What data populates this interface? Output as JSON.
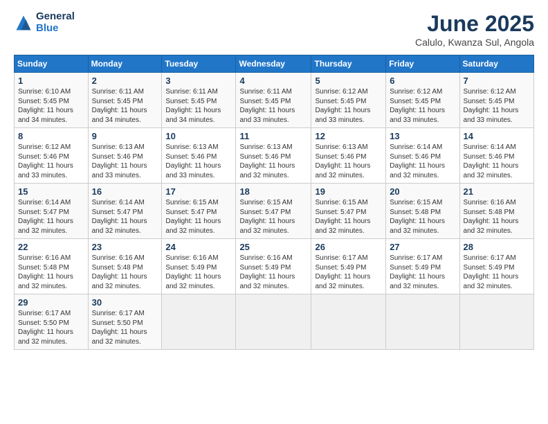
{
  "logo": {
    "line1": "General",
    "line2": "Blue"
  },
  "title": "June 2025",
  "subtitle": "Calulo, Kwanza Sul, Angola",
  "days_of_week": [
    "Sunday",
    "Monday",
    "Tuesday",
    "Wednesday",
    "Thursday",
    "Friday",
    "Saturday"
  ],
  "weeks": [
    [
      {
        "day": "1",
        "info": "Sunrise: 6:10 AM\nSunset: 5:45 PM\nDaylight: 11 hours\nand 34 minutes."
      },
      {
        "day": "2",
        "info": "Sunrise: 6:11 AM\nSunset: 5:45 PM\nDaylight: 11 hours\nand 34 minutes."
      },
      {
        "day": "3",
        "info": "Sunrise: 6:11 AM\nSunset: 5:45 PM\nDaylight: 11 hours\nand 34 minutes."
      },
      {
        "day": "4",
        "info": "Sunrise: 6:11 AM\nSunset: 5:45 PM\nDaylight: 11 hours\nand 33 minutes."
      },
      {
        "day": "5",
        "info": "Sunrise: 6:12 AM\nSunset: 5:45 PM\nDaylight: 11 hours\nand 33 minutes."
      },
      {
        "day": "6",
        "info": "Sunrise: 6:12 AM\nSunset: 5:45 PM\nDaylight: 11 hours\nand 33 minutes."
      },
      {
        "day": "7",
        "info": "Sunrise: 6:12 AM\nSunset: 5:45 PM\nDaylight: 11 hours\nand 33 minutes."
      }
    ],
    [
      {
        "day": "8",
        "info": "Sunrise: 6:12 AM\nSunset: 5:46 PM\nDaylight: 11 hours\nand 33 minutes."
      },
      {
        "day": "9",
        "info": "Sunrise: 6:13 AM\nSunset: 5:46 PM\nDaylight: 11 hours\nand 33 minutes."
      },
      {
        "day": "10",
        "info": "Sunrise: 6:13 AM\nSunset: 5:46 PM\nDaylight: 11 hours\nand 33 minutes."
      },
      {
        "day": "11",
        "info": "Sunrise: 6:13 AM\nSunset: 5:46 PM\nDaylight: 11 hours\nand 32 minutes."
      },
      {
        "day": "12",
        "info": "Sunrise: 6:13 AM\nSunset: 5:46 PM\nDaylight: 11 hours\nand 32 minutes."
      },
      {
        "day": "13",
        "info": "Sunrise: 6:14 AM\nSunset: 5:46 PM\nDaylight: 11 hours\nand 32 minutes."
      },
      {
        "day": "14",
        "info": "Sunrise: 6:14 AM\nSunset: 5:46 PM\nDaylight: 11 hours\nand 32 minutes."
      }
    ],
    [
      {
        "day": "15",
        "info": "Sunrise: 6:14 AM\nSunset: 5:47 PM\nDaylight: 11 hours\nand 32 minutes."
      },
      {
        "day": "16",
        "info": "Sunrise: 6:14 AM\nSunset: 5:47 PM\nDaylight: 11 hours\nand 32 minutes."
      },
      {
        "day": "17",
        "info": "Sunrise: 6:15 AM\nSunset: 5:47 PM\nDaylight: 11 hours\nand 32 minutes."
      },
      {
        "day": "18",
        "info": "Sunrise: 6:15 AM\nSunset: 5:47 PM\nDaylight: 11 hours\nand 32 minutes."
      },
      {
        "day": "19",
        "info": "Sunrise: 6:15 AM\nSunset: 5:47 PM\nDaylight: 11 hours\nand 32 minutes."
      },
      {
        "day": "20",
        "info": "Sunrise: 6:15 AM\nSunset: 5:48 PM\nDaylight: 11 hours\nand 32 minutes."
      },
      {
        "day": "21",
        "info": "Sunrise: 6:16 AM\nSunset: 5:48 PM\nDaylight: 11 hours\nand 32 minutes."
      }
    ],
    [
      {
        "day": "22",
        "info": "Sunrise: 6:16 AM\nSunset: 5:48 PM\nDaylight: 11 hours\nand 32 minutes."
      },
      {
        "day": "23",
        "info": "Sunrise: 6:16 AM\nSunset: 5:48 PM\nDaylight: 11 hours\nand 32 minutes."
      },
      {
        "day": "24",
        "info": "Sunrise: 6:16 AM\nSunset: 5:49 PM\nDaylight: 11 hours\nand 32 minutes."
      },
      {
        "day": "25",
        "info": "Sunrise: 6:16 AM\nSunset: 5:49 PM\nDaylight: 11 hours\nand 32 minutes."
      },
      {
        "day": "26",
        "info": "Sunrise: 6:17 AM\nSunset: 5:49 PM\nDaylight: 11 hours\nand 32 minutes."
      },
      {
        "day": "27",
        "info": "Sunrise: 6:17 AM\nSunset: 5:49 PM\nDaylight: 11 hours\nand 32 minutes."
      },
      {
        "day": "28",
        "info": "Sunrise: 6:17 AM\nSunset: 5:49 PM\nDaylight: 11 hours\nand 32 minutes."
      }
    ],
    [
      {
        "day": "29",
        "info": "Sunrise: 6:17 AM\nSunset: 5:50 PM\nDaylight: 11 hours\nand 32 minutes."
      },
      {
        "day": "30",
        "info": "Sunrise: 6:17 AM\nSunset: 5:50 PM\nDaylight: 11 hours\nand 32 minutes."
      },
      {
        "day": "",
        "info": ""
      },
      {
        "day": "",
        "info": ""
      },
      {
        "day": "",
        "info": ""
      },
      {
        "day": "",
        "info": ""
      },
      {
        "day": "",
        "info": ""
      }
    ]
  ]
}
